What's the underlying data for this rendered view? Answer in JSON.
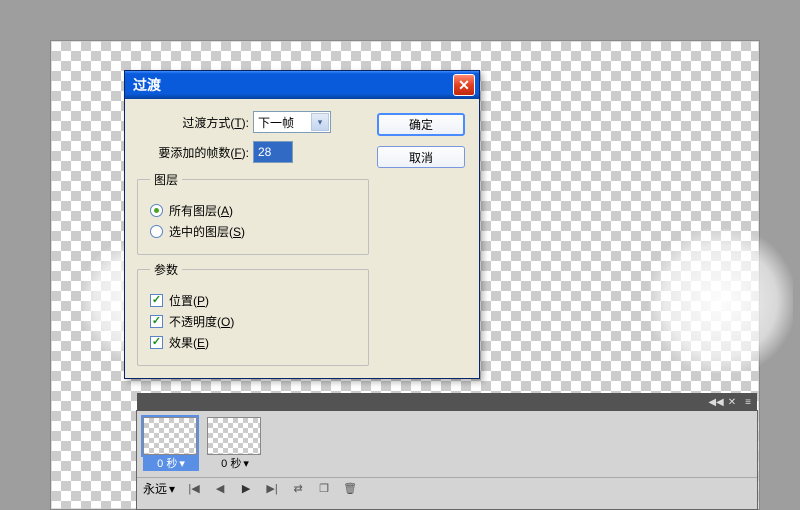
{
  "dialog": {
    "title": "过渡",
    "transition_label_pre": "过渡方式(",
    "transition_hotkey": "T",
    "transition_label_post": "):",
    "transition_value": "下一帧",
    "frames_label_pre": "要添加的帧数(",
    "frames_hotkey": "F",
    "frames_label_post": "):",
    "frames_value": "28",
    "ok": "确定",
    "cancel": "取消",
    "layers_legend": "图层",
    "layers_all_pre": "所有图层(",
    "layers_all_hot": "A",
    "layers_all_post": ")",
    "layers_sel_pre": "选中的图层(",
    "layers_sel_hot": "S",
    "layers_sel_post": ")",
    "params_legend": "参数",
    "param_pos_pre": "位置(",
    "param_pos_hot": "P",
    "param_pos_post": ")",
    "param_opa_pre": "不透明度(",
    "param_opa_hot": "O",
    "param_opa_post": ")",
    "param_eff_pre": "效果(",
    "param_eff_hot": "E",
    "param_eff_post": ")"
  },
  "timeline": {
    "frames": [
      {
        "label": "0 秒",
        "dropdown": "▾"
      },
      {
        "label": "0 秒",
        "dropdown": "▾"
      }
    ],
    "loop_label": "永远",
    "loop_dropdown": "▾"
  }
}
